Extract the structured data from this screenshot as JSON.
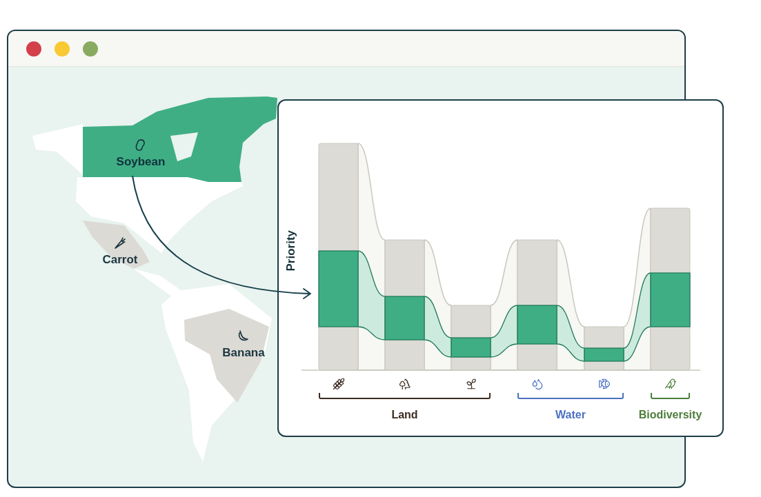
{
  "window": {
    "controls": [
      {
        "color": "#d3404a"
      },
      {
        "color": "#f8c932"
      },
      {
        "color": "#89ab5f"
      }
    ]
  },
  "map": {
    "crops": [
      {
        "name": "Soybean",
        "selected": true
      },
      {
        "name": "Carrot",
        "selected": false
      },
      {
        "name": "Banana",
        "selected": false
      }
    ]
  },
  "chart": {
    "ylabel": "Priority",
    "groups": [
      {
        "label": "Land",
        "color": "#3b2a1f"
      },
      {
        "label": "Water",
        "color": "#4a70c0"
      },
      {
        "label": "Biodiversity",
        "color": "#4b7d3a"
      }
    ]
  }
}
